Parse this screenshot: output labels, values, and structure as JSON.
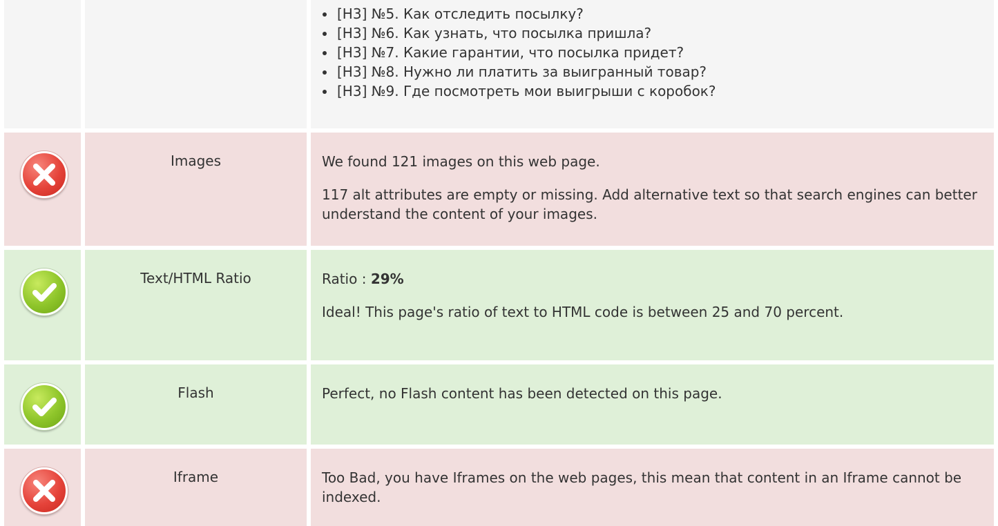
{
  "faq": {
    "items": [
      "[H3] №5. Как отследить посылку?",
      "[H3] №6. Как узнать, что посылка пришла?",
      "[H3] №7. Какие гарантии, что посылка придет?",
      "[H3] №8. Нужно ли платить за выигранный товар?",
      "[H3] №9. Где посмотреть мои выигрыши с коробок?"
    ]
  },
  "checks": {
    "images": {
      "status": "fail",
      "icon": "cross-icon",
      "label": "Images",
      "line1": "We found 121 images on this web page.",
      "line2": "117 alt attributes are empty or missing. Add alternative text so that search engines can better understand the content of your images."
    },
    "ratio": {
      "status": "pass",
      "icon": "check-icon",
      "label": "Text/HTML Ratio",
      "ratio_prefix": "Ratio : ",
      "ratio_value": "29%",
      "line2": "Ideal! This page's ratio of text to HTML code is between 25 and 70 percent."
    },
    "flash": {
      "status": "pass",
      "icon": "check-icon",
      "label": "Flash",
      "line1": "Perfect, no Flash content has been detected on this page."
    },
    "iframe": {
      "status": "fail",
      "icon": "cross-icon",
      "label": "Iframe",
      "line1": "Too Bad, you have Iframes on the web pages, this mean that content in an Iframe cannot be indexed."
    }
  },
  "colors": {
    "fail_bg": "#f2dede",
    "pass_bg": "#dff0d8",
    "neutral_bg": "#f5f5f5",
    "fail_icon": "#e5433a",
    "pass_icon": "#8ec52a"
  }
}
